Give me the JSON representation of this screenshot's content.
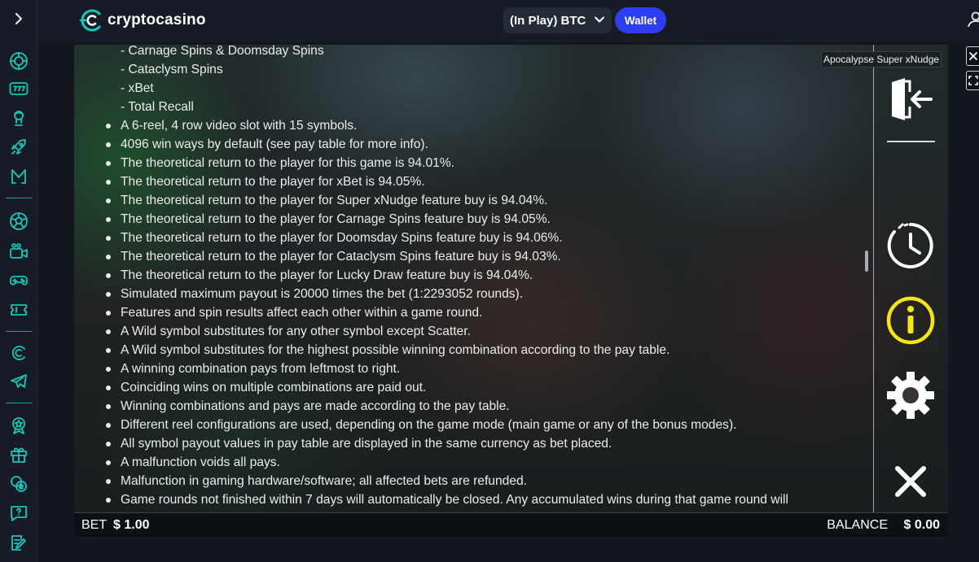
{
  "brand": {
    "name": "cryptocasino",
    "accent": "#14c9b9"
  },
  "header": {
    "currency_selector": "(In Play) BTC",
    "wallet_label": "Wallet"
  },
  "sidebar": {
    "items": [
      {
        "icon": "casino-chip-icon"
      },
      {
        "icon": "slots-777-icon"
      },
      {
        "icon": "live-dealer-icon"
      },
      {
        "icon": "rocket-icon"
      },
      {
        "icon": "originals-m-icon"
      },
      {
        "icon": "sports-ball-icon"
      },
      {
        "icon": "live-stream-icon"
      },
      {
        "icon": "gamepad-icon"
      },
      {
        "icon": "ticket-icon"
      },
      {
        "icon": "cryptocasino-logo-icon"
      },
      {
        "icon": "telegram-icon"
      },
      {
        "icon": "vip-badge-icon"
      },
      {
        "icon": "gift-icon"
      },
      {
        "icon": "bonus-coin-icon"
      },
      {
        "icon": "support-chat-icon"
      },
      {
        "icon": "edit-note-icon"
      }
    ]
  },
  "game": {
    "tooltip": "Apocalypse Super xNudge",
    "sub_items": [
      "- Carnage Spins & Doomsday Spins",
      "- Cataclysm Spins",
      "- xBet",
      "- Total Recall"
    ],
    "bullets": [
      "A 6-reel, 4 row video slot with 15 symbols.",
      "4096 win ways by default (see pay table for more info).",
      "The theoretical return to the player for this game is 94.01%.",
      "The theoretical return to the player for xBet is 94.05%.",
      "The theoretical return to the player for Super xNudge feature buy is 94.04%.",
      "The theoretical return to the player for Carnage Spins feature buy is 94.05%.",
      "The theoretical return to the player for Doomsday Spins feature buy is 94.06%.",
      "The theoretical return to the player for Cataclysm Spins feature buy is 94.03%.",
      "The theoretical return to the player for Lucky Draw feature buy is 94.04%.",
      "Simulated maximum payout is 20000 times the bet (1:2293052 rounds).",
      "Features and spin results affect each other within a game round.",
      "A Wild symbol substitutes for any other symbol except Scatter.",
      "A Wild symbol substitutes for the highest possible winning combination according to the pay table.",
      "A winning combination pays from leftmost to right.",
      "Coinciding wins on multiple combinations are paid out.",
      "Winning combinations and pays are made according to the pay table.",
      "Different reel configurations are used, depending on the game mode (main game or any of the bonus modes).",
      "All symbol payout values in pay table are displayed in the same currency as bet placed.",
      "A malfunction voids all pays.",
      "Malfunction in gaming hardware/software; all affected bets are refunded.",
      "Game rounds not finished within 7 days will automatically be closed. Any accumulated wins during that game round will"
    ],
    "controls": {
      "exit_icon": "exit-door-icon",
      "history_icon": "history-clock-icon",
      "info_icon": "info-icon",
      "settings_icon": "gear-icon",
      "close_icon": "close-icon",
      "info_color": "#f5e70a"
    },
    "bottombar": {
      "bet_label": "BET",
      "bet_value": "$ 1.00",
      "balance_label": "BALANCE",
      "balance_value": "$ 0.00"
    }
  }
}
